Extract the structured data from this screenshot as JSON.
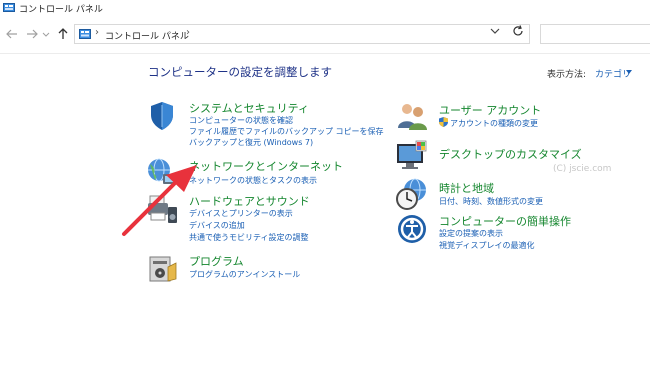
{
  "window": {
    "title": "コントロール パネル"
  },
  "address": {
    "crumb": "コントロール パネル",
    "sep": "›"
  },
  "search": {
    "placeholder": ""
  },
  "heading": "コンピューターの設定を調整します",
  "view_by": {
    "label": "表示方法:",
    "value": "カテゴリ"
  },
  "watermark": "(C) jscie.com",
  "categories": [
    {
      "title": "システムとセキュリティ",
      "links": [
        "コンピューターの状態を確認",
        "ファイル履歴でファイルのバックアップ コピーを保存",
        "バックアップと復元 (Windows 7)"
      ],
      "icon": "shield-icon"
    },
    {
      "title": "ネットワークとインターネット",
      "links": [
        "ネットワークの状態とタスクの表示"
      ],
      "icon": "network-globe-icon"
    },
    {
      "title": "ハードウェアとサウンド",
      "links": [
        "デバイスとプリンターの表示",
        "デバイスの追加",
        "共通で使うモビリティ設定の調整"
      ],
      "icon": "printer-speaker-icon"
    },
    {
      "title": "プログラム",
      "links": [
        "プログラムのアンインストール"
      ],
      "icon": "programs-icon"
    },
    {
      "title": "ユーザー アカウント",
      "links": [
        "アカウントの種類の変更"
      ],
      "icon": "users-icon"
    },
    {
      "title": "デスクトップのカスタマイズ",
      "links": [],
      "icon": "desktop-monitor-icon"
    },
    {
      "title": "時計と地域",
      "links": [
        "日付、時刻、数値形式の変更"
      ],
      "icon": "clock-globe-icon"
    },
    {
      "title": "コンピューターの簡単操作",
      "links": [
        "設定の提案の表示",
        "視覚ディスプレイの最適化"
      ],
      "icon": "ease-of-access-icon"
    }
  ],
  "colors": {
    "heading": "#1e3287",
    "category_title": "#14862e",
    "link": "#1a5fb4",
    "arrow": "#e8323c"
  }
}
